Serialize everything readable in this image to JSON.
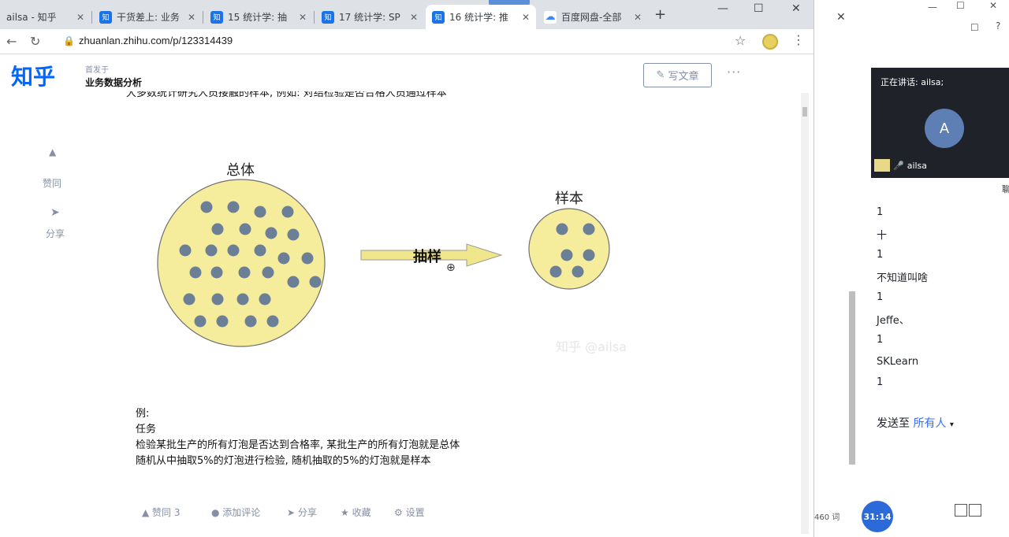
{
  "browser": {
    "tabs": [
      {
        "label": "ailsa - 知乎",
        "favicon": ""
      },
      {
        "label": "干货差上: 业务",
        "favicon": "知"
      },
      {
        "label": "15 统计学: 抽",
        "favicon": "知"
      },
      {
        "label": "17 统计学: SP",
        "favicon": "知"
      },
      {
        "label": "16 统计学: 推",
        "favicon": "知"
      },
      {
        "label": "百度网盘-全部",
        "favicon": "cloud-icon"
      }
    ],
    "new_tab": "+",
    "url": "zhuanlan.zhihu.com/p/123314439",
    "window_controls": {
      "minimize": "—",
      "maximize": "☐",
      "close": "✕"
    }
  },
  "header": {
    "logo": "知乎",
    "subtitle": "首发于",
    "column_title": "业务数据分析",
    "write_button": "写文章",
    "more": "···"
  },
  "article": {
    "cut_text": "大多数统计研究人员接触的样本, 例如: 对结检验是否合格人员通过样本",
    "diagram": {
      "population_label": "总体",
      "sample_label": "样本",
      "arrow_label": "抽样",
      "watermark": "知乎 @ailsa",
      "population_color": "#f5ec9c",
      "dot_color": "#6b7f96"
    },
    "body": {
      "line1": "例:",
      "line2": "任务",
      "line3": "检验某批生产的所有灯泡是否达到合格率, 某批生产的所有灯泡就是总体",
      "line4": "随机从中抽取5%的灯泡进行检验, 随机抽取的5%的灯泡就是样本"
    }
  },
  "rail": {
    "like": "赞同",
    "share": "分享"
  },
  "actions": {
    "like": "赞同 3",
    "comment": "添加评论",
    "share": "分享",
    "favorite": "收藏",
    "settings": "设置"
  },
  "side_panel": {
    "speaking": "正在讲话: ailsa;",
    "avatar_letter": "A",
    "video_name": "ailsa",
    "chat": [
      "1",
      "十",
      "1",
      "不知道叫啥",
      "1",
      "Jeffe、",
      "1",
      "SKLearn",
      "1"
    ],
    "send_to_label": "发送至",
    "send_to_target": "所有人",
    "word_count": "460 词",
    "timer": "31:14",
    "cut_char": "聊"
  }
}
